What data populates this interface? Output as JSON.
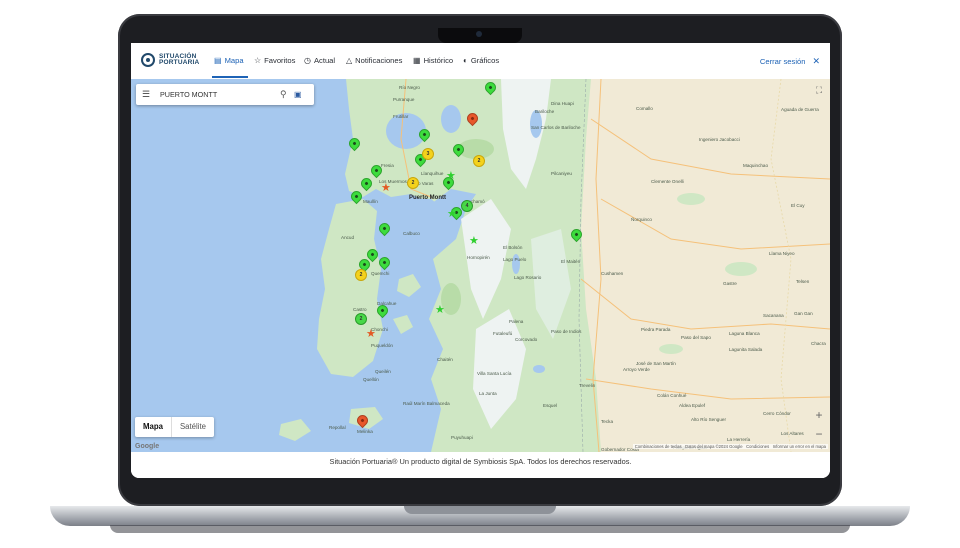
{
  "nav": {
    "logo_line1": "SITUACIÓN",
    "logo_line2": "PORTUARIA",
    "items": [
      {
        "label": "Mapa",
        "icon": "map-icon"
      },
      {
        "label": "Favoritos",
        "icon": "star-icon"
      },
      {
        "label": "Actual",
        "icon": "clock-icon"
      },
      {
        "label": "Notificaciones",
        "icon": "bell-icon"
      },
      {
        "label": "Histórico",
        "icon": "calendar-icon"
      },
      {
        "label": "Gráficos",
        "icon": "chart-icon"
      }
    ],
    "active": "Mapa",
    "logout_label": "Cerrar sesión"
  },
  "search": {
    "value": "PUERTO MONTT"
  },
  "map": {
    "type_options": [
      "Mapa",
      "Satélite"
    ],
    "selected_type": "Mapa",
    "google_logo": "Google",
    "attribution": [
      "Combinaciones de teclas",
      "Datos del mapa ©2024 Google",
      "Condiciones",
      "Informar un error en el mapa"
    ],
    "places": [
      "Río Negro",
      "Purranque",
      "Frutillar",
      "Llanquihue",
      "Puerto Varas",
      "Fresia",
      "Los Muermos",
      "Maullín",
      "Puerto Montt",
      "Calbuco",
      "Ancud",
      "Cochamó",
      "Quemchi",
      "Dalcahue",
      "Castro",
      "Chonchi",
      "Queilén",
      "Quellón",
      "Puqueldón",
      "Chaitén",
      "Hornopirén",
      "El Bolsón",
      "Lago Puelo",
      "El Maitén",
      "Corcovado",
      "Futaleufú",
      "Palena",
      "Raúl Marín Balmaceda",
      "La Junta",
      "Puyuhuapi",
      "Repollal",
      "Melinka",
      "Villa Santa Lucía",
      "Bariloche",
      "San Carlos de Bariloche",
      "Dina Huapi",
      "Pilcaniyeu",
      "Comallo",
      "Aguada de Guerra",
      "Ingeniero Jacobacci",
      "Maquinchao",
      "Clemente Onelli",
      "Ñorquinco",
      "Cushamen",
      "Gastre",
      "Telsen",
      "Paso de Indios",
      "Esquel",
      "Trevelin",
      "Tecka",
      "Gobernador Costa",
      "José de San Martín",
      "Alto Río Senguer",
      "Piedra Parada",
      "Paso del Sapo",
      "Gan Gan",
      "Laguna Blanca",
      "Lagunita Salada",
      "Colán Conhué",
      "Aldea Epulef",
      "Cerro Cóndor",
      "Los Altares",
      "La Herrería",
      "Pampa de Agnia",
      "Arroyo Verde",
      "Chonchi",
      "El Cuy",
      "Lago Rosario",
      "Llama Niyeo",
      "Sacanana",
      "Chacra"
    ],
    "markers": {
      "green_pins": 16,
      "red_pins": 3,
      "green_stars": 3,
      "red_stars": 2,
      "clusters": [
        {
          "label": "3",
          "color": "yellow"
        },
        {
          "label": "2",
          "color": "yellow"
        },
        {
          "label": "2",
          "color": "yellow"
        },
        {
          "label": "2",
          "color": "yellow"
        },
        {
          "label": "4",
          "color": "green"
        },
        {
          "label": "2",
          "color": "green"
        }
      ]
    }
  },
  "footer": {
    "text": "Situación Portuaria® Un producto digital de Symbiosis SpA. Todos los derechos reservados."
  },
  "colors": {
    "accent": "#1e63b6",
    "brand": "#21496b",
    "green_marker": "#3ddc3d",
    "red_marker": "#e8572b",
    "yellow_cluster": "#f4d21c",
    "water": "#a6c8ee",
    "land": "#cfe7c4"
  }
}
